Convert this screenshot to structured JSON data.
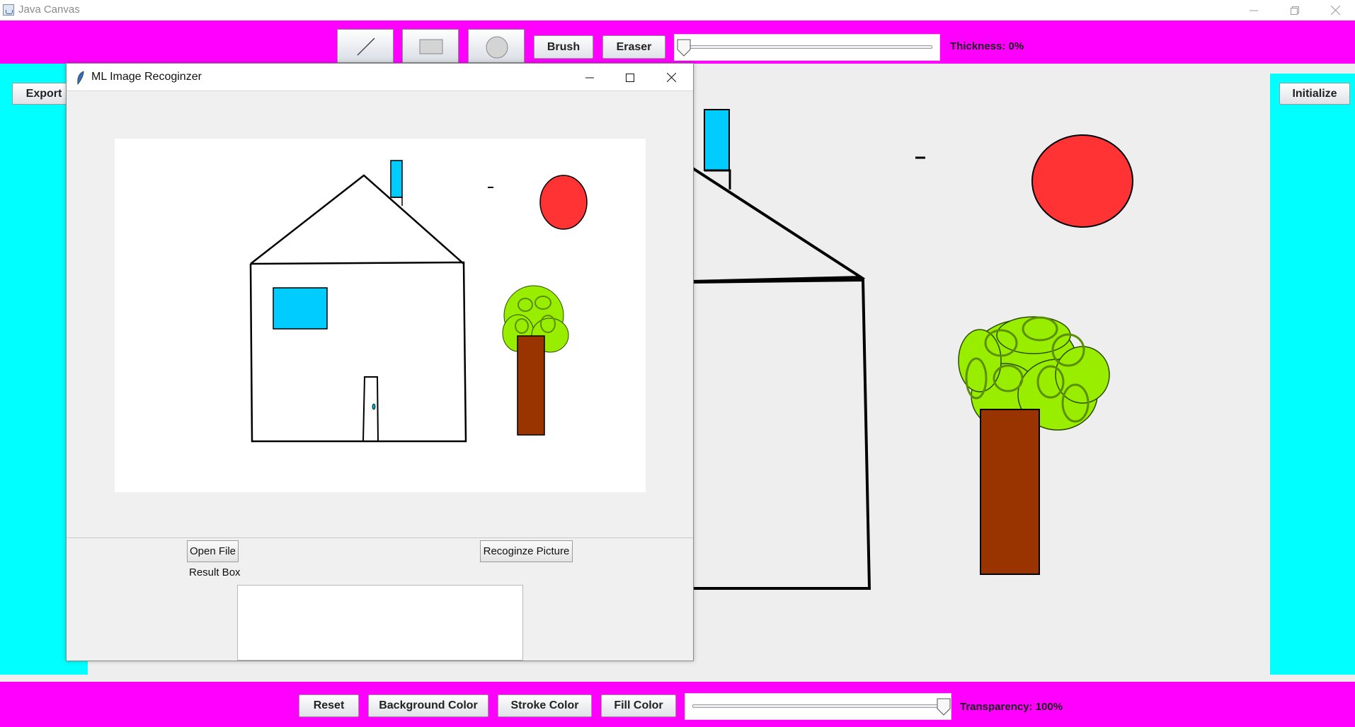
{
  "window": {
    "title": "Java Canvas",
    "controls": [
      "minimize-icon",
      "restore-icon",
      "close-icon"
    ]
  },
  "toolbar_top": {
    "tools": [
      {
        "name": "line-tool",
        "icon": "line-icon"
      },
      {
        "name": "rectangle-tool",
        "icon": "rectangle-icon"
      },
      {
        "name": "ellipse-tool",
        "icon": "ellipse-icon"
      }
    ],
    "brush_label": "Brush",
    "eraser_label": "Eraser",
    "thickness_label": "Thickness: 0%",
    "thickness_value": 0
  },
  "side": {
    "export_label": "Export",
    "initialize_label": "Initialize"
  },
  "toolbar_bottom": {
    "reset_label": "Reset",
    "background_color_label": "Background Color",
    "stroke_color_label": "Stroke Color",
    "fill_color_label": "Fill Color",
    "transparency_label": "Transparency: 100%",
    "transparency_value": 100
  },
  "dialog": {
    "title": "ML Image Recoginzer",
    "open_file_label": "Open File",
    "recognize_label": "Recoginze Picture",
    "result_label": "Result Box",
    "result_value": ""
  },
  "colors": {
    "toolbar": "#ff00ff",
    "side_panel": "#00ffff",
    "sun": "#ff3333",
    "window_fill": "#00ccff",
    "trunk": "#993300",
    "leaves": "#99ee00"
  }
}
